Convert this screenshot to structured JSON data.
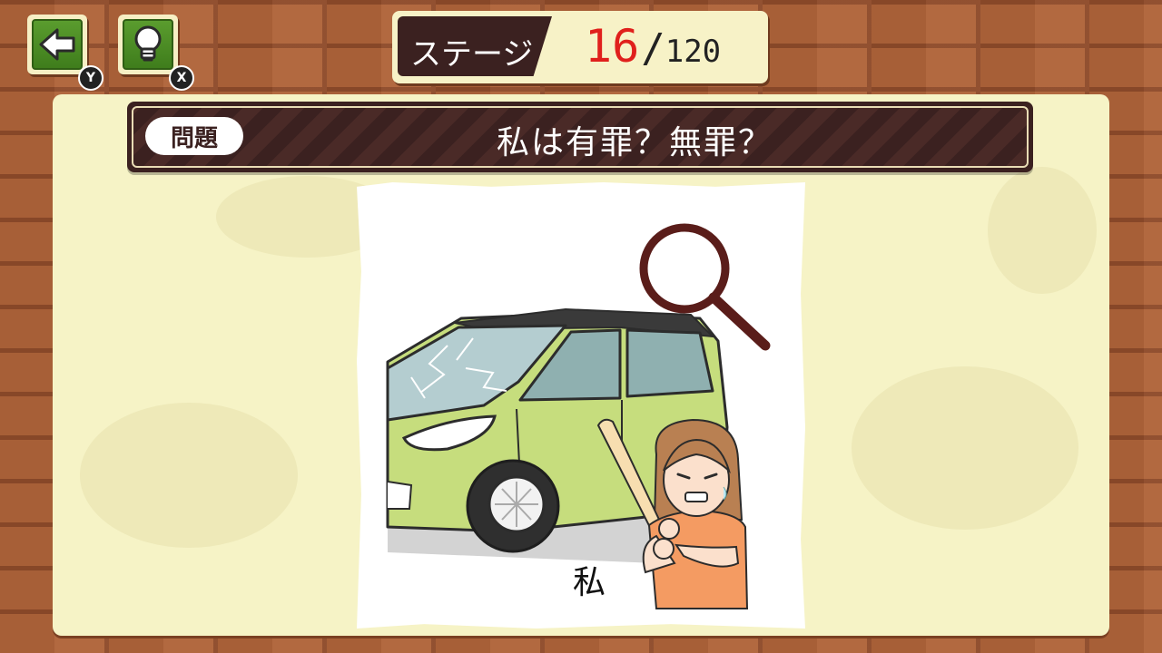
{
  "toolbar": {
    "back_button": {
      "icon": "back-arrow-icon",
      "key": "Y"
    },
    "hint_button": {
      "icon": "lightbulb-icon",
      "key": "X"
    }
  },
  "stage": {
    "label": "ステージ",
    "current": "16",
    "separator": "/",
    "total": "120"
  },
  "question": {
    "tag": "問題",
    "text": "私は有罪？無罪？"
  },
  "picture": {
    "me_label": "私"
  },
  "colors": {
    "brick": "#b0643a",
    "board": "#f6f3c6",
    "dark_brown": "#3b2120",
    "button_green": "#4a8c24",
    "stage_number": "#e0201c"
  }
}
